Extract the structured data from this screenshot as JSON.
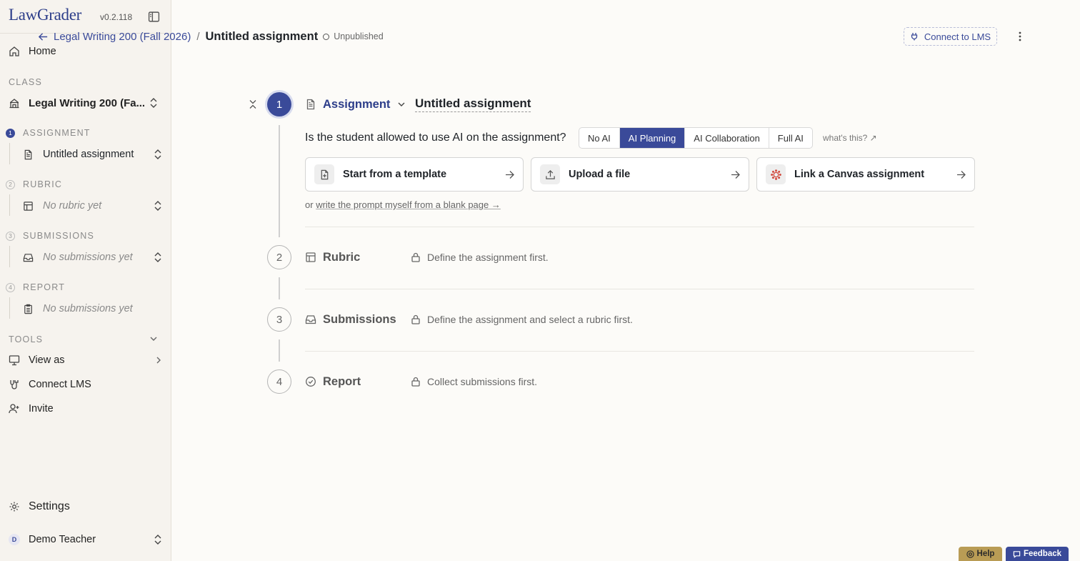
{
  "app": {
    "logo": "LawGrader",
    "version": "v0.2.118"
  },
  "sidebar": {
    "home": "Home",
    "class_label": "CLASS",
    "class_name": "Legal Writing 200 (Fa...",
    "steps": [
      {
        "num": "1",
        "label": "ASSIGNMENT",
        "item": "Untitled assignment"
      },
      {
        "num": "2",
        "label": "RUBRIC",
        "item": "No rubric yet"
      },
      {
        "num": "3",
        "label": "SUBMISSIONS",
        "item": "No submissions yet"
      },
      {
        "num": "4",
        "label": "REPORT",
        "item": "No submissions yet"
      }
    ],
    "tools_label": "TOOLS",
    "tools": [
      "View as",
      "Connect LMS",
      "Invite"
    ],
    "settings": "Settings",
    "user": {
      "initial": "D",
      "name": "Demo Teacher"
    }
  },
  "header": {
    "breadcrumb_class": "Legal Writing 200 (Fall 2026)",
    "separator": "/",
    "title": "Untitled assignment",
    "status": "Unpublished",
    "connect_button": "Connect to LMS"
  },
  "steps": [
    {
      "num": "1",
      "name": "Assignment",
      "title": "Untitled assignment"
    },
    {
      "num": "2",
      "name": "Rubric",
      "locked_msg": "Define the assignment first."
    },
    {
      "num": "3",
      "name": "Submissions",
      "locked_msg": "Define the assignment and select a rubric first."
    },
    {
      "num": "4",
      "name": "Report",
      "locked_msg": "Collect submissions first."
    }
  ],
  "ai_policy": {
    "question": "Is the student allowed to use AI on the assignment?",
    "options": [
      "No AI",
      "AI Planning",
      "AI Collaboration",
      "Full AI"
    ],
    "selected": "AI Planning",
    "help_link": "what's this? ↗"
  },
  "start_cards": [
    {
      "label": "Start from a template",
      "icon": "file-plus-icon"
    },
    {
      "label": "Upload a file",
      "icon": "upload-icon"
    },
    {
      "label": "Link a Canvas assignment",
      "icon": "canvas-icon"
    }
  ],
  "blank_prefix": "or",
  "blank_link": "write the prompt myself from a blank page →",
  "footer": {
    "help": "Help",
    "feedback": "Feedback"
  },
  "colors": {
    "accent": "#3a4a99",
    "help": "#b99c55"
  }
}
